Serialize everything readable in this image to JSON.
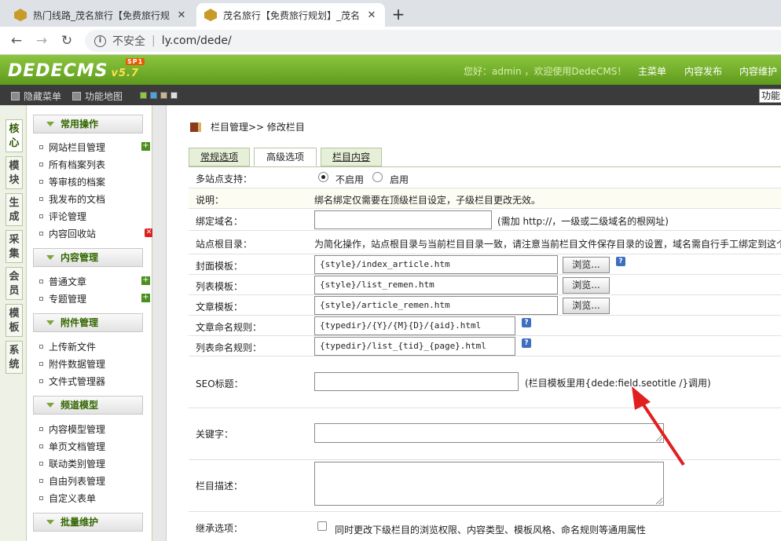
{
  "browser": {
    "tabs": [
      {
        "title": "热门线路_茂名旅行【免费旅行规",
        "close": "✕"
      },
      {
        "title": "茂名旅行【免费旅行规划】_茂名",
        "close": "✕"
      }
    ],
    "new_tab": "+",
    "security": "不安全",
    "url": "ly.com/dede/"
  },
  "header": {
    "logo": "DEDECMS",
    "logo_badge": "SP1",
    "version": "v5.7",
    "welcome": "您好：admin ，欢迎使用DedeCMS！",
    "nav": [
      "主菜单",
      "内容发布",
      "内容维护"
    ]
  },
  "toolbar": {
    "hide_menu": "隐藏菜单",
    "sitemap": "功能地图",
    "swatch_colors": [
      "#8dc63f",
      "#4aa3df",
      "#c8b68a",
      "#dddddd"
    ],
    "func_box": "功能"
  },
  "vtabs": [
    {
      "label": "核心",
      "active": true
    },
    {
      "label": "模块",
      "active": false
    },
    {
      "label": "生成",
      "active": false
    },
    {
      "label": "采集",
      "active": false
    },
    {
      "label": "会员",
      "active": false
    },
    {
      "label": "模板",
      "active": false
    },
    {
      "label": "系统",
      "active": false
    }
  ],
  "menu": {
    "groups": [
      {
        "title": "常用操作",
        "items": [
          "网站栏目管理",
          "所有档案列表",
          "等审核的档案",
          "我发布的文档",
          "评论管理",
          "内容回收站"
        ]
      },
      {
        "title": "内容管理",
        "items": [
          "普通文章",
          "专题管理"
        ]
      },
      {
        "title": "附件管理",
        "items": [
          "上传新文件",
          "附件数据管理",
          "文件式管理器"
        ]
      },
      {
        "title": "频道模型",
        "items": [
          "内容模型管理",
          "单页文档管理",
          "联动类别管理",
          "自由列表管理",
          "自定义表单"
        ]
      },
      {
        "title": "批量维护",
        "items": []
      }
    ]
  },
  "main": {
    "breadcrumb": "栏目管理>>  修改栏目",
    "tabs": [
      "常规选项",
      "高级选项",
      "栏目内容"
    ],
    "fields": {
      "multisite_label": "多站点支持：",
      "multisite_off": "不启用",
      "multisite_on": "启用",
      "note_label": "说明：",
      "note_text": "绑名绑定仅需要在顶级栏目设定，子级栏目更改无效。",
      "domain_label": "绑定域名：",
      "domain_value": "",
      "domain_hint": "(需加 http://，一级或二级域名的根网址)",
      "root_label": "站点根目录：",
      "root_text": "为简化操作，站点根目录与当前栏目目录一致，请注意当前栏目文件保存目录的设置，域名需自行手工绑定到这个目录。",
      "cover_tpl_label": "封面模板：",
      "cover_tpl_value": "{style}/index_article.htm",
      "list_tpl_label": "列表模板：",
      "list_tpl_value": "{style}/list_remen.htm",
      "article_tpl_label": "文章模板：",
      "article_tpl_value": "{style}/article_remen.htm",
      "browse": "浏览...",
      "article_rule_label": "文章命名规则：",
      "article_rule_value": "{typedir}/{Y}/{M}{D}/{aid}.html",
      "list_rule_label": "列表命名规则：",
      "list_rule_value": "{typedir}/list_{tid}_{page}.html",
      "seo_label": "SEO标题：",
      "seo_value": "",
      "seo_hint": "(栏目模板里用{dede:field.seotitle /}调用)",
      "keywords_label": "关键字：",
      "desc_label": "栏目描述：",
      "inherit_label": "继承选项：",
      "inherit_text": "同时更改下级栏目的浏览权限、内容类型、模板风格、命名规则等通用属性",
      "help": "?"
    },
    "annotation_color": "#e02020"
  }
}
